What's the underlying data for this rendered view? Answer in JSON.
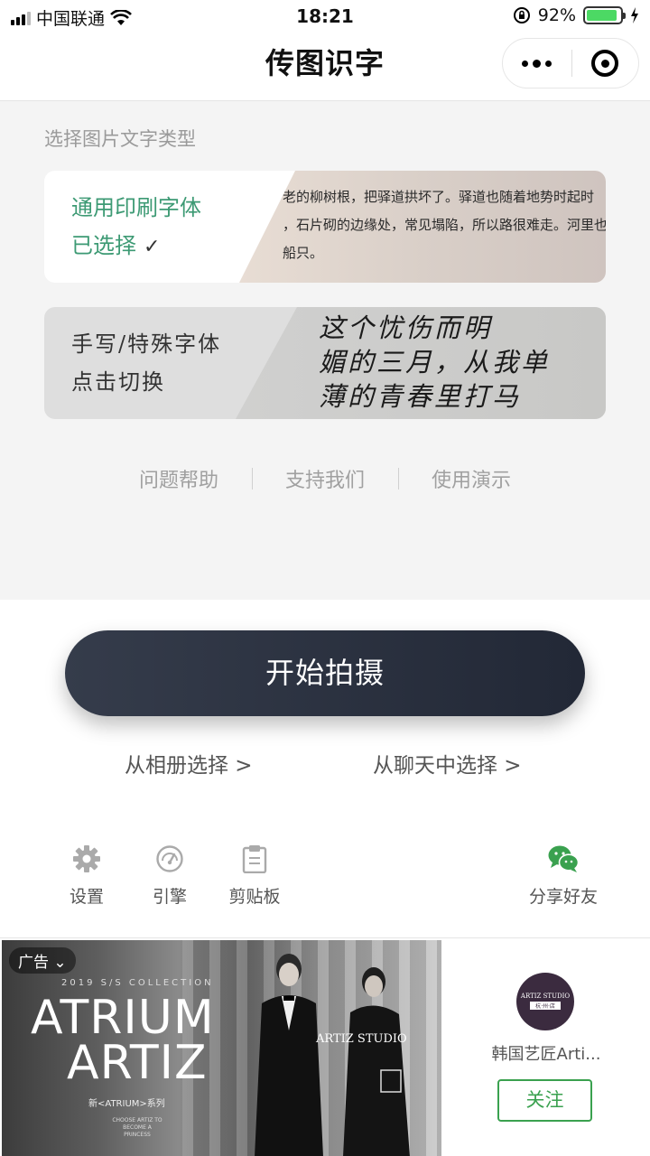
{
  "status": {
    "carrier": "中国联通",
    "time": "18:21",
    "battery": "92%",
    "battery_level": 0.92,
    "icons": [
      "signal-icon",
      "wifi-icon",
      "orientation-lock-icon",
      "battery-icon",
      "charging-icon"
    ]
  },
  "nav": {
    "title": "传图识字",
    "more_icon": "more-icon",
    "close_icon": "target-circle-icon"
  },
  "select": {
    "label": "选择图片文字类型",
    "printed": {
      "title": "通用印刷字体",
      "status": "已选择",
      "check": "✓",
      "sample_lines": [
        "老的柳树根，把驿道拱坏了。驿道也随着地势时起时",
        "，石片砌的边缘处，常见塌陷，所以路很难走。河里也不见",
        "船只。"
      ]
    },
    "handwritten": {
      "title": "手写/特殊字体",
      "status": "点击切换",
      "sample_lines": [
        "这个忧伤而明",
        "媚的三月，从我单",
        "薄的青春里打马"
      ]
    }
  },
  "links": [
    "问题帮助",
    "支持我们",
    "使用演示"
  ],
  "start_button": "开始拍摄",
  "choose": {
    "album": "从相册选择 >",
    "chat": "从聊天中选择 >"
  },
  "tools": {
    "settings": "设置",
    "engine": "引擎",
    "clipboard": "剪贴板",
    "share": "分享好友"
  },
  "colors": {
    "accent_green": "#3d9a74",
    "wechat_green": "#3aa14f",
    "button_dark": "#2a303e"
  },
  "ad": {
    "badge": "广告",
    "collection": "2019 S/S COLLECTION",
    "title1": "ATRIUM",
    "title2": "ARTIZ",
    "series": "新<ATRIUM>系列",
    "tagline": "CHOOSE ARTIZ TO BECOME A PRINCESS",
    "studio": "ARTIZ STUDIO",
    "logo_top": "ARTIZ STUDIO",
    "logo_bottom": "杭·州·店",
    "name": "韩国艺匠Arti...",
    "follow": "关注"
  }
}
